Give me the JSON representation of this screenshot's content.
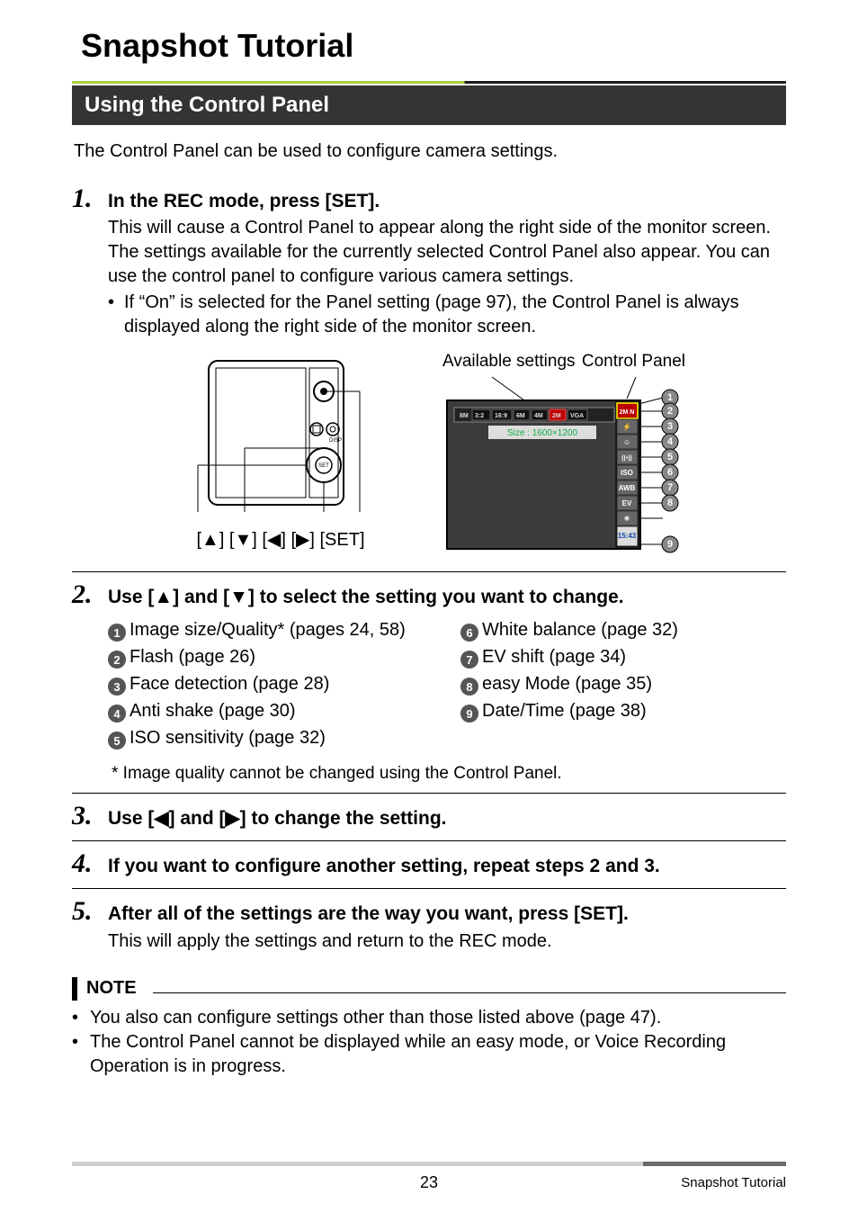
{
  "title": "Snapshot Tutorial",
  "section": "Using the Control Panel",
  "intro": "The Control Panel can be used to configure camera settings.",
  "diagram": {
    "available_label": "Available settings",
    "panel_label": "Control Panel",
    "keys": "[▲] [▼] [◀] [▶]    [SET]",
    "screen_size_text": "Size : 1600×1200",
    "size_tabs": [
      "8M",
      "3:2",
      "16:9",
      "6M",
      "4M",
      "2M",
      "VGA"
    ],
    "panel_icons": [
      "2M N",
      "⚡",
      "☺",
      "((•))",
      "ISO",
      "AWB",
      "EV",
      "※",
      "15:43"
    ]
  },
  "steps": [
    {
      "num": "1.",
      "head": "In the REC mode, press [SET].",
      "body": "This will cause a Control Panel to appear along the right side of the monitor screen. The settings available for the currently selected Control Panel also appear. You can use the control panel to configure various camera settings.",
      "bullet": "If “On” is selected for the Panel setting (page 97), the Control Panel is always displayed along the right side of the monitor screen."
    },
    {
      "num": "2.",
      "head": "Use [▲] and [▼] to select the setting you want to change."
    },
    {
      "num": "3.",
      "head": "Use [◀] and [▶] to change the setting."
    },
    {
      "num": "4.",
      "head": "If you want to configure another setting, repeat steps 2 and 3."
    },
    {
      "num": "5.",
      "head": "After all of the settings are the way you want, press [SET].",
      "body": "This will apply the settings and return to the REC mode."
    }
  ],
  "settings_left": [
    {
      "n": "1",
      "t": "Image size/Quality* (pages 24, 58)"
    },
    {
      "n": "2",
      "t": "Flash (page 26)"
    },
    {
      "n": "3",
      "t": "Face detection (page 28)"
    },
    {
      "n": "4",
      "t": "Anti shake (page 30)"
    },
    {
      "n": "5",
      "t": "ISO sensitivity (page 32)"
    }
  ],
  "settings_right": [
    {
      "n": "6",
      "t": "White balance (page 32)"
    },
    {
      "n": "7",
      "t": "EV shift (page 34)"
    },
    {
      "n": "8",
      "t": "easy Mode (page 35)"
    },
    {
      "n": "9",
      "t": "Date/Time (page 38)"
    }
  ],
  "footnote": "* Image quality cannot be changed using the Control Panel.",
  "note_title": "NOTE",
  "notes": [
    "You also can configure settings other than those listed above (page 47).",
    "The Control Panel cannot be displayed while an easy mode, or Voice Recording Operation is in progress."
  ],
  "footer": {
    "page": "23",
    "section": "Snapshot Tutorial"
  }
}
